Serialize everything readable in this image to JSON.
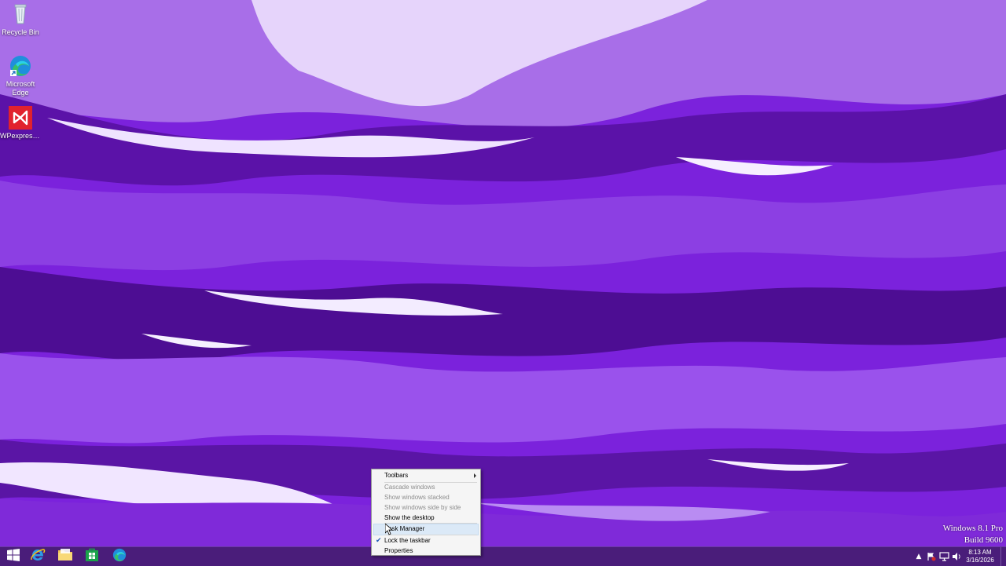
{
  "desktop": {
    "icons": [
      {
        "label": "Recycle Bin",
        "icon": "recycle-bin-icon"
      },
      {
        "label": "Microsoft Edge",
        "icon": "edge-icon"
      },
      {
        "label": "WPexpress ...",
        "icon": "visual-studio-icon"
      }
    ],
    "watermark": {
      "line1": "Windows 8.1 Pro",
      "line2": "Build 9600"
    }
  },
  "context_menu": {
    "items": [
      {
        "label": "Toolbars",
        "submenu": true,
        "enabled": true
      },
      {
        "label": "Cascade windows",
        "enabled": false
      },
      {
        "label": "Show windows stacked",
        "enabled": false
      },
      {
        "label": "Show windows side by side",
        "enabled": false
      },
      {
        "label": "Show the desktop",
        "enabled": true
      },
      {
        "label": "Task Manager",
        "enabled": true,
        "highlighted": true
      },
      {
        "label": "Lock the taskbar",
        "enabled": true,
        "checked": true
      },
      {
        "label": "Properties",
        "enabled": true
      }
    ]
  },
  "taskbar": {
    "pinned": [
      {
        "name": "start-button",
        "icon": "windows-logo-icon"
      },
      {
        "name": "internet-explorer",
        "icon": "ie-icon"
      },
      {
        "name": "file-explorer",
        "icon": "folder-icon"
      },
      {
        "name": "store",
        "icon": "store-icon"
      },
      {
        "name": "microsoft-edge",
        "icon": "edge-icon"
      }
    ],
    "tray": {
      "time": "8:13 AM",
      "date": "3/16/2026",
      "icons": [
        "show-hidden-icons",
        "action-center-flag-icon",
        "network-icon",
        "volume-icon"
      ]
    }
  },
  "colors": {
    "taskbar": "#4a1d7a",
    "menu_bg": "#f5f5f5",
    "menu_highlight": "#dbe9f7"
  }
}
